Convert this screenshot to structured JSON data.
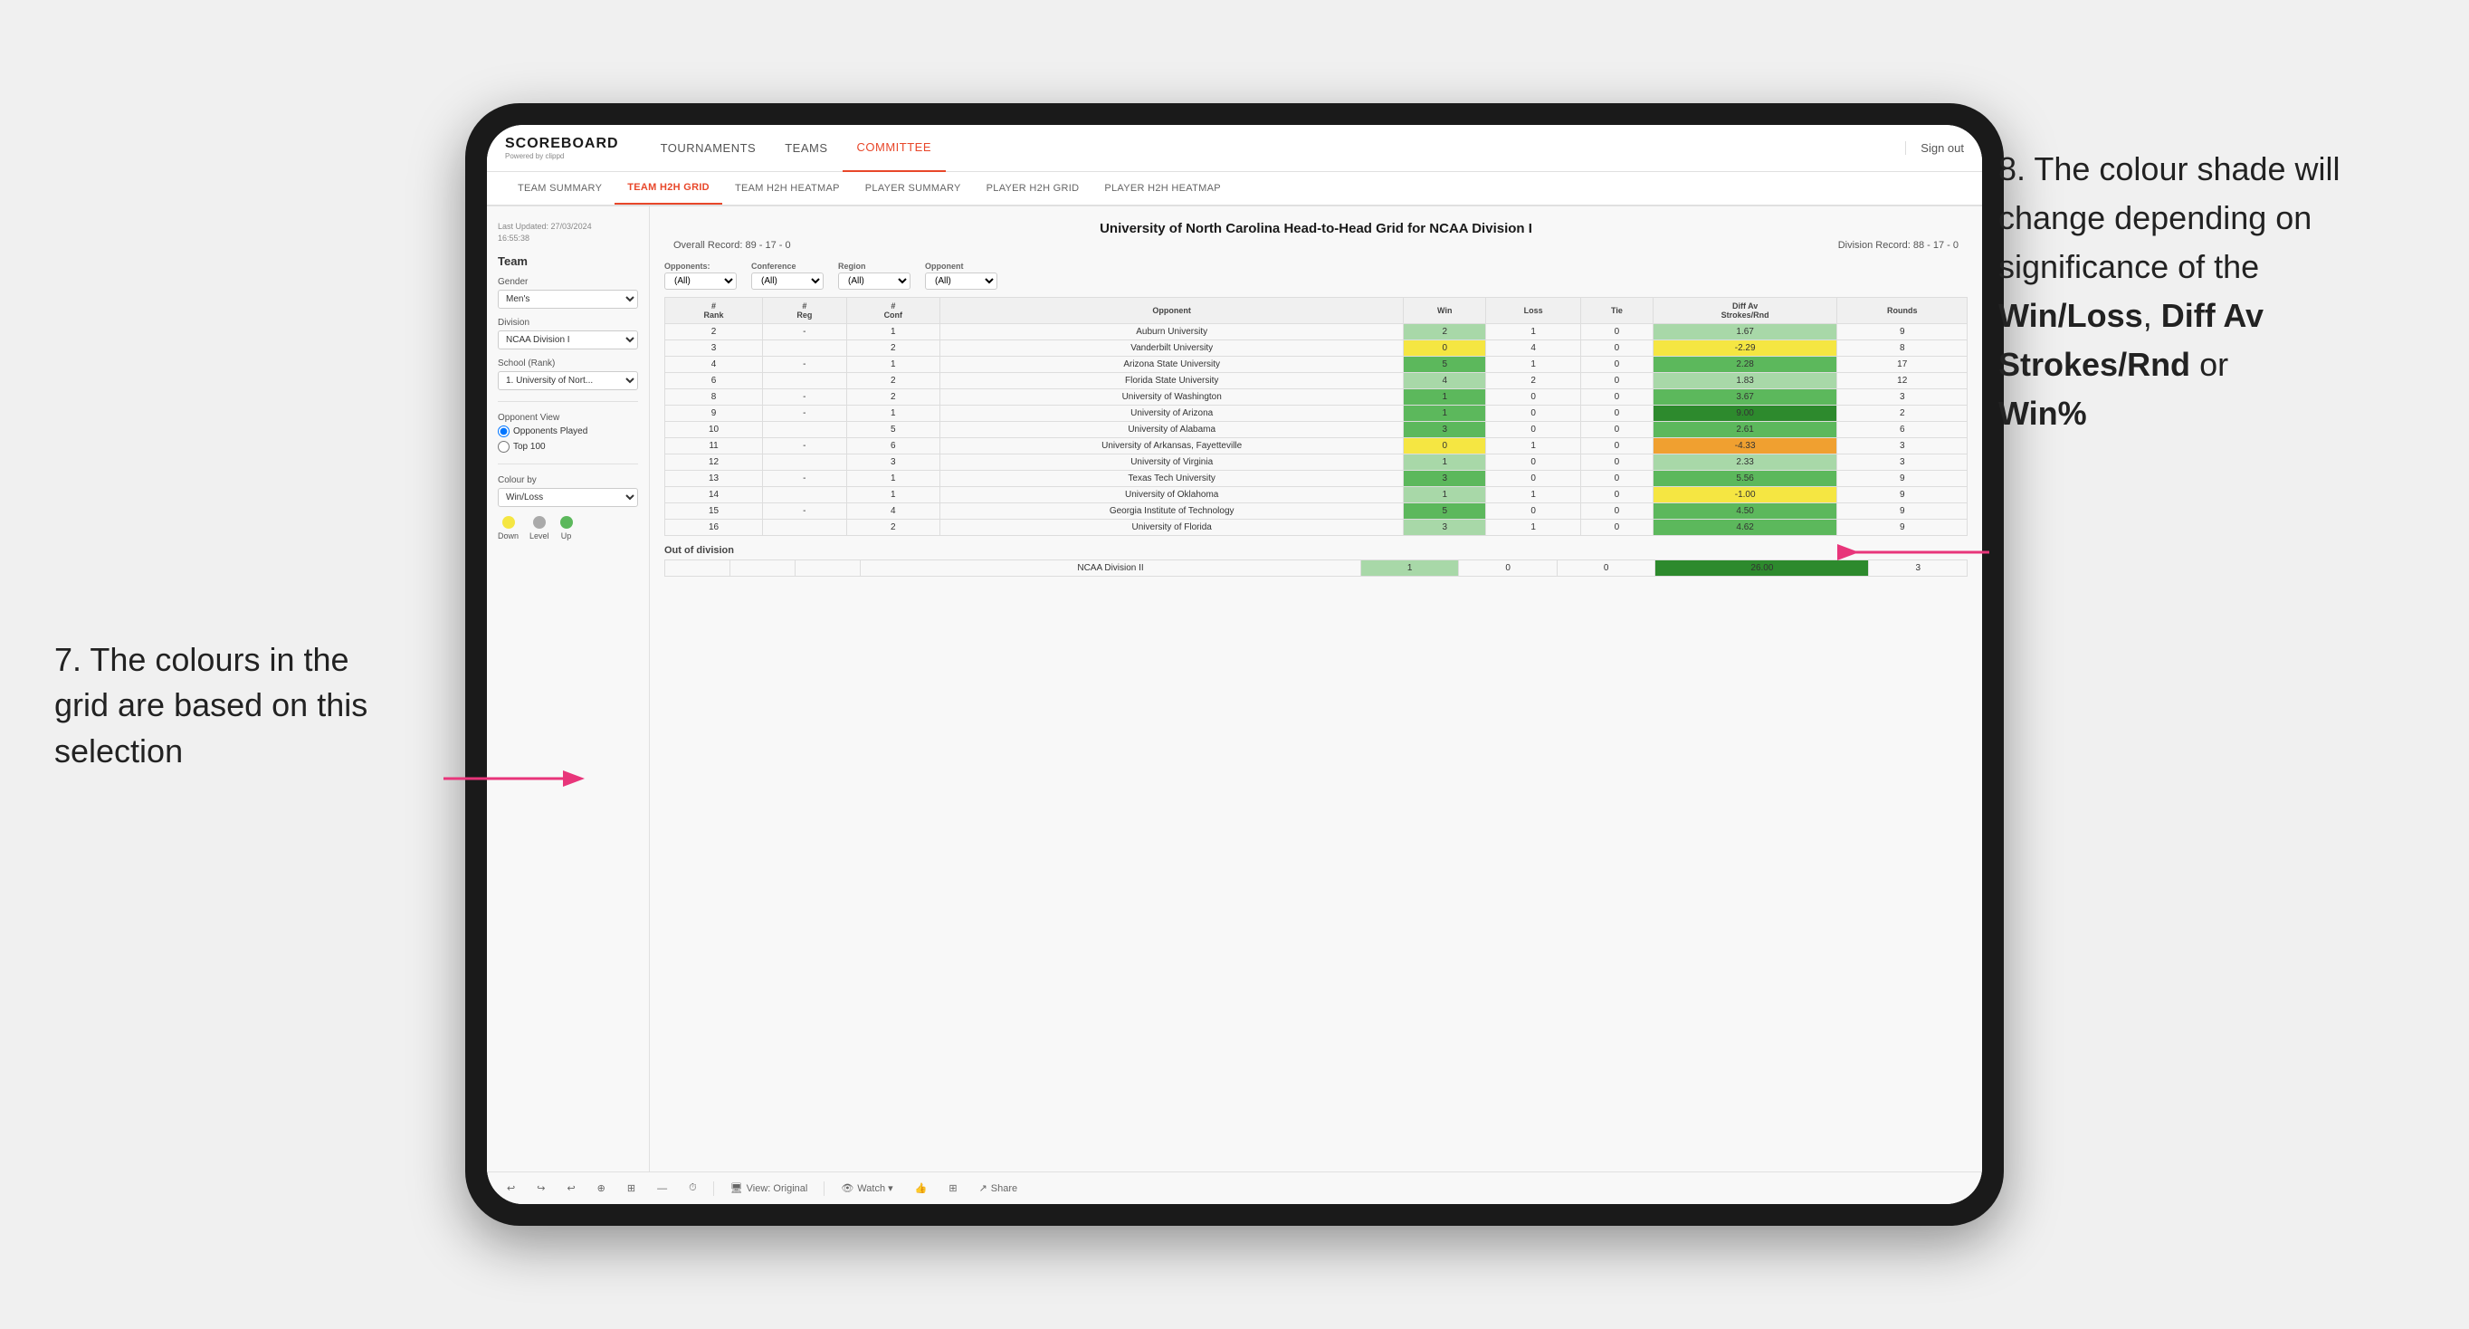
{
  "annotations": {
    "left_text": "7. The colours in the grid are based on this selection",
    "right_title": "8. The colour shade will change depending on significance of the",
    "right_bold1": "Win/Loss",
    "right_comma": ", ",
    "right_bold2": "Diff Av Strokes/Rnd",
    "right_or": " or",
    "right_bold3": "Win%"
  },
  "header": {
    "logo": "SCOREBOARD",
    "logo_sub": "Powered by clippd",
    "nav": [
      "TOURNAMENTS",
      "TEAMS",
      "COMMITTEE"
    ],
    "active_nav": "COMMITTEE",
    "sign_out": "Sign out"
  },
  "sub_nav": {
    "items": [
      "TEAM SUMMARY",
      "TEAM H2H GRID",
      "TEAM H2H HEATMAP",
      "PLAYER SUMMARY",
      "PLAYER H2H GRID",
      "PLAYER H2H HEATMAP"
    ],
    "active": "TEAM H2H GRID"
  },
  "sidebar": {
    "meta": "Last Updated: 27/03/2024\n16:55:38",
    "section_title": "Team",
    "gender_label": "Gender",
    "gender_value": "Men's",
    "division_label": "Division",
    "division_value": "NCAA Division I",
    "school_label": "School (Rank)",
    "school_value": "1. University of Nort...",
    "opponent_view_label": "Opponent View",
    "radio_options": [
      "Opponents Played",
      "Top 100"
    ],
    "radio_selected": "Opponents Played",
    "colour_by_label": "Colour by",
    "colour_by_value": "Win/Loss",
    "legend": [
      {
        "color": "#f5e642",
        "label": "Down"
      },
      {
        "color": "#aaaaaa",
        "label": "Level"
      },
      {
        "color": "#5cb85c",
        "label": "Up"
      }
    ]
  },
  "grid": {
    "title": "University of North Carolina Head-to-Head Grid for NCAA Division I",
    "overall_record": "89 - 17 - 0",
    "division_record": "88 - 17 - 0",
    "filters": {
      "opponents_label": "Opponents:",
      "opponents_value": "(All)",
      "conference_label": "Conference",
      "conference_value": "(All)",
      "region_label": "Region",
      "region_value": "(All)",
      "opponent_label": "Opponent",
      "opponent_value": "(All)"
    },
    "columns": [
      "#\nRank",
      "#\nReg",
      "#\nConf",
      "Opponent",
      "Win",
      "Loss",
      "Tie",
      "Diff Av\nStrokes/Rnd",
      "Rounds"
    ],
    "rows": [
      {
        "rank": "2",
        "reg": "-",
        "conf": "1",
        "opponent": "Auburn University",
        "win": "2",
        "loss": "1",
        "tie": "0",
        "diff": "1.67",
        "rounds": "9",
        "win_color": "green-light",
        "diff_color": "green-light"
      },
      {
        "rank": "3",
        "reg": "",
        "conf": "2",
        "opponent": "Vanderbilt University",
        "win": "0",
        "loss": "4",
        "tie": "0",
        "diff": "-2.29",
        "rounds": "8",
        "win_color": "yellow",
        "diff_color": "yellow"
      },
      {
        "rank": "4",
        "reg": "-",
        "conf": "1",
        "opponent": "Arizona State University",
        "win": "5",
        "loss": "1",
        "tie": "0",
        "diff": "2.28",
        "rounds": "17",
        "win_color": "green-med",
        "diff_color": "green-med"
      },
      {
        "rank": "6",
        "reg": "",
        "conf": "2",
        "opponent": "Florida State University",
        "win": "4",
        "loss": "2",
        "tie": "0",
        "diff": "1.83",
        "rounds": "12",
        "win_color": "green-light",
        "diff_color": "green-light"
      },
      {
        "rank": "8",
        "reg": "-",
        "conf": "2",
        "opponent": "University of Washington",
        "win": "1",
        "loss": "0",
        "tie": "0",
        "diff": "3.67",
        "rounds": "3",
        "win_color": "green-med",
        "diff_color": "green-med"
      },
      {
        "rank": "9",
        "reg": "-",
        "conf": "1",
        "opponent": "University of Arizona",
        "win": "1",
        "loss": "0",
        "tie": "0",
        "diff": "9.00",
        "rounds": "2",
        "win_color": "green-med",
        "diff_color": "green-dark"
      },
      {
        "rank": "10",
        "reg": "",
        "conf": "5",
        "opponent": "University of Alabama",
        "win": "3",
        "loss": "0",
        "tie": "0",
        "diff": "2.61",
        "rounds": "6",
        "win_color": "green-med",
        "diff_color": "green-med"
      },
      {
        "rank": "11",
        "reg": "-",
        "conf": "6",
        "opponent": "University of Arkansas, Fayetteville",
        "win": "0",
        "loss": "1",
        "tie": "0",
        "diff": "-4.33",
        "rounds": "3",
        "win_color": "yellow",
        "diff_color": "orange"
      },
      {
        "rank": "12",
        "reg": "",
        "conf": "3",
        "opponent": "University of Virginia",
        "win": "1",
        "loss": "0",
        "tie": "0",
        "diff": "2.33",
        "rounds": "3",
        "win_color": "green-light",
        "diff_color": "green-light"
      },
      {
        "rank": "13",
        "reg": "-",
        "conf": "1",
        "opponent": "Texas Tech University",
        "win": "3",
        "loss": "0",
        "tie": "0",
        "diff": "5.56",
        "rounds": "9",
        "win_color": "green-med",
        "diff_color": "green-med"
      },
      {
        "rank": "14",
        "reg": "",
        "conf": "1",
        "opponent": "University of Oklahoma",
        "win": "1",
        "loss": "1",
        "tie": "0",
        "diff": "-1.00",
        "rounds": "9",
        "win_color": "green-light",
        "diff_color": "yellow"
      },
      {
        "rank": "15",
        "reg": "-",
        "conf": "4",
        "opponent": "Georgia Institute of Technology",
        "win": "5",
        "loss": "0",
        "tie": "0",
        "diff": "4.50",
        "rounds": "9",
        "win_color": "green-med",
        "diff_color": "green-med"
      },
      {
        "rank": "16",
        "reg": "",
        "conf": "2",
        "opponent": "University of Florida",
        "win": "3",
        "loss": "1",
        "tie": "0",
        "diff": "4.62",
        "rounds": "9",
        "win_color": "green-light",
        "diff_color": "green-med"
      }
    ],
    "out_of_division_label": "Out of division",
    "out_of_division_row": {
      "division": "NCAA Division II",
      "win": "1",
      "loss": "0",
      "tie": "0",
      "diff": "26.00",
      "rounds": "3",
      "diff_color": "green-dark"
    }
  },
  "toolbar": {
    "view_label": "View: Original",
    "watch_label": "Watch ▾",
    "share_label": "Share"
  }
}
